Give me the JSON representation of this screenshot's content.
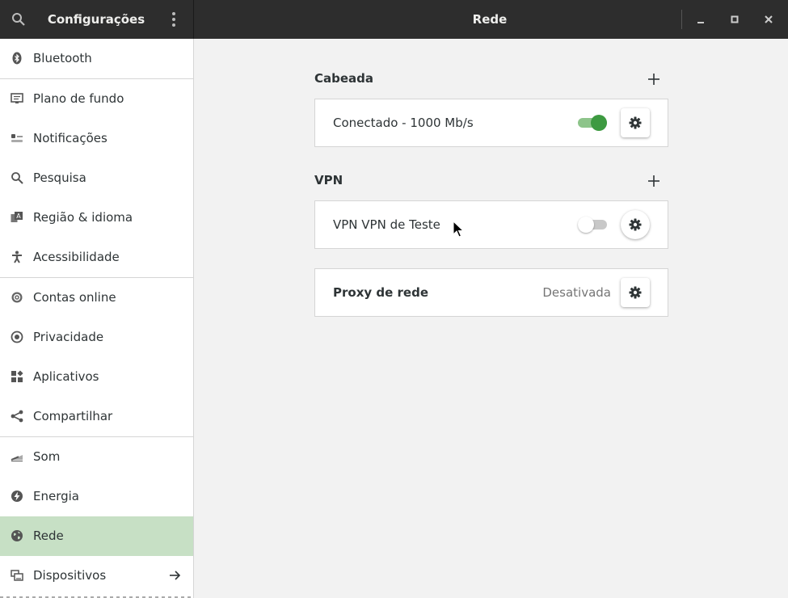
{
  "header": {
    "app_title": "Configurações",
    "panel_title": "Rede"
  },
  "sidebar": {
    "items": [
      {
        "label": "Bluetooth",
        "icon": "bluetooth-icon"
      },
      {
        "label": "Plano de fundo",
        "icon": "background-icon"
      },
      {
        "label": "Notificações",
        "icon": "notifications-icon"
      },
      {
        "label": "Pesquisa",
        "icon": "search-icon"
      },
      {
        "label": "Região & idioma",
        "icon": "region-icon"
      },
      {
        "label": "Acessibilidade",
        "icon": "accessibility-icon"
      },
      {
        "label": "Contas online",
        "icon": "online-accounts-icon"
      },
      {
        "label": "Privacidade",
        "icon": "privacy-icon"
      },
      {
        "label": "Aplicativos",
        "icon": "applications-icon"
      },
      {
        "label": "Compartilhar",
        "icon": "share-icon"
      },
      {
        "label": "Som",
        "icon": "sound-icon"
      },
      {
        "label": "Energia",
        "icon": "power-icon"
      },
      {
        "label": "Rede",
        "icon": "network-icon",
        "selected": true
      },
      {
        "label": "Dispositivos",
        "icon": "devices-icon"
      }
    ]
  },
  "main": {
    "wired": {
      "title": "Cabeada",
      "connection_label": "Conectado - 1000 Mb/s",
      "enabled": true
    },
    "vpn": {
      "title": "VPN",
      "connection_label": "VPN VPN de Teste",
      "enabled": false
    },
    "proxy": {
      "label": "Proxy de rede",
      "status": "Desativada"
    }
  },
  "colors": {
    "header_bg": "#2d2d2d",
    "selected_bg": "#c7e0c5",
    "toggle_on": "#3d9a41"
  }
}
